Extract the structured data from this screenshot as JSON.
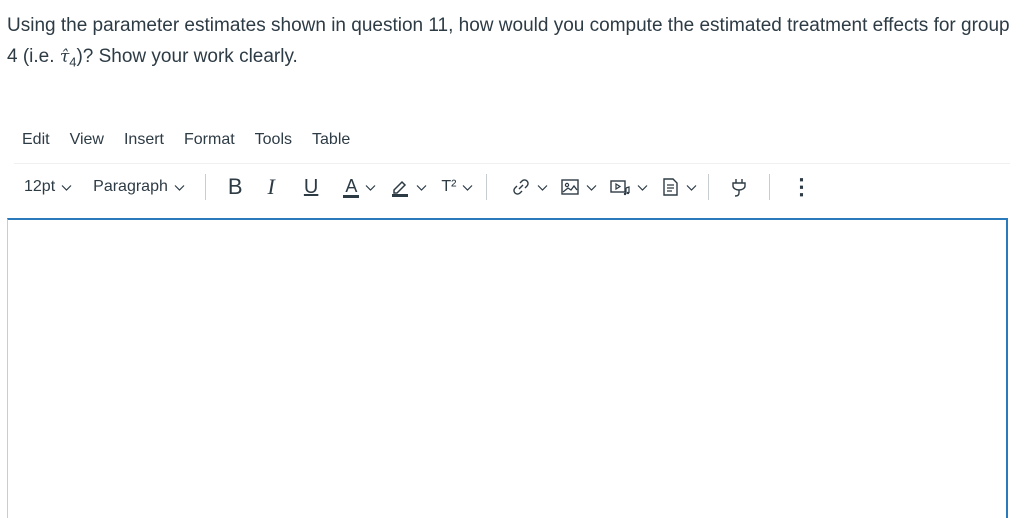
{
  "question": {
    "text_before": "Using the parameter estimates shown in question 11, how would you compute the estimated treatment effects for group 4 (i.e. ",
    "symbol": "τ̂",
    "subscript": "4",
    "text_after": ")? Show your work clearly."
  },
  "menubar": {
    "edit": "Edit",
    "view": "View",
    "insert": "Insert",
    "format": "Format",
    "tools": "Tools",
    "table": "Table"
  },
  "toolbar": {
    "font_size": "12pt",
    "block_format": "Paragraph",
    "bold": "B",
    "italic": "I",
    "underline": "U",
    "text_color": "A",
    "superscript": "T²",
    "more": "⋮"
  },
  "colors": {
    "text": "#2d3b45",
    "accent": "#2b7abc",
    "border": "#c7cdd1"
  },
  "editor": {
    "content": ""
  }
}
